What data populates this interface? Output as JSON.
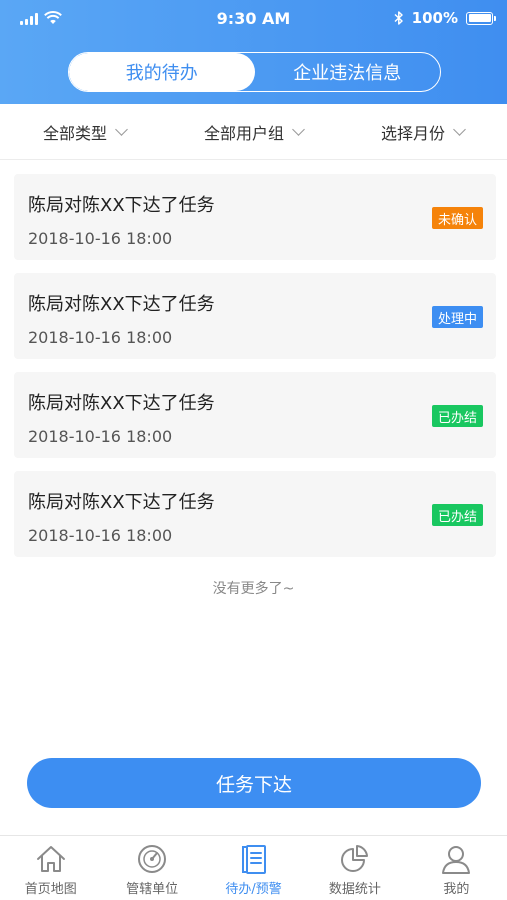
{
  "status_bar": {
    "time": "9:30 AM",
    "battery": "100%",
    "battery_level": 1.0
  },
  "header": {
    "tabs": [
      {
        "label": "我的待办",
        "active": true
      },
      {
        "label": "企业违法信息",
        "active": false
      }
    ]
  },
  "filters": [
    {
      "label": "全部类型"
    },
    {
      "label": "全部用户组"
    },
    {
      "label": "选择月份"
    }
  ],
  "tasks": [
    {
      "title": "陈局对陈XX下达了任务",
      "datetime": "2018-10-16  18:00",
      "status": "未确认",
      "status_color": "#f5830a"
    },
    {
      "title": "陈局对陈XX下达了任务",
      "datetime": "2018-10-16  18:00",
      "status": "处理中",
      "status_color": "#3d8ef2"
    },
    {
      "title": "陈局对陈XX下达了任务",
      "datetime": "2018-10-16  18:00",
      "status": "已办结",
      "status_color": "#19c760"
    },
    {
      "title": "陈局对陈XX下达了任务",
      "datetime": "2018-10-16  18:00",
      "status": "已办结",
      "status_color": "#19c760"
    }
  ],
  "list_footer": "没有更多了~",
  "primary_button": "任务下达",
  "tabbar": [
    {
      "label": "首页地图",
      "icon": "home-icon",
      "active": false
    },
    {
      "label": "管辖单位",
      "icon": "dashboard-icon",
      "active": false
    },
    {
      "label": "待办/预警",
      "icon": "document-icon",
      "active": true
    },
    {
      "label": "数据统计",
      "icon": "pie-chart-icon",
      "active": false
    },
    {
      "label": "我的",
      "icon": "user-icon",
      "active": false
    }
  ],
  "colors": {
    "accent": "#3f8ef0",
    "inactive_icon": "#8a8a8a"
  }
}
